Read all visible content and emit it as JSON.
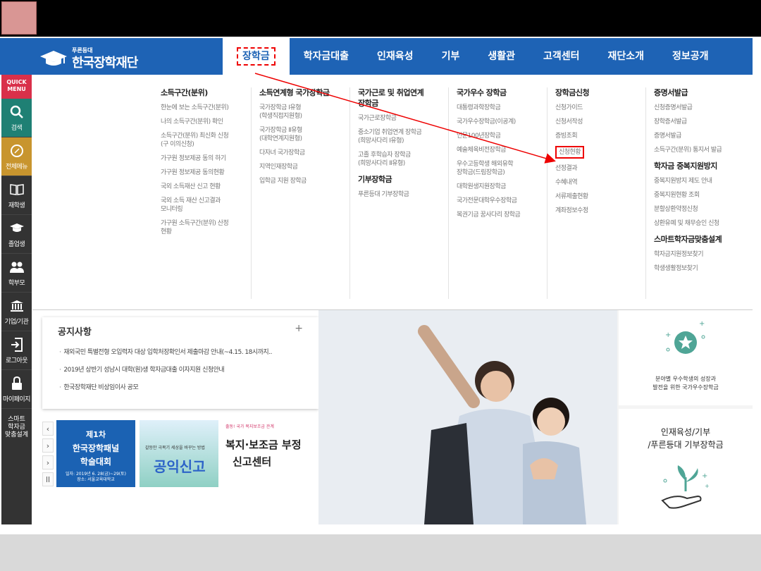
{
  "logo": {
    "small": "푸른등대",
    "name": "한국장학재단"
  },
  "nav": {
    "items": [
      "장학금",
      "학자금대출",
      "인재육성",
      "기부",
      "생활관",
      "고객센터",
      "재단소개",
      "정보공개"
    ]
  },
  "quick_menu": {
    "title_line1": "QUICK",
    "title_line2": "MENU",
    "items": [
      "검색",
      "전체메뉴",
      "재학생",
      "졸업생",
      "학부모",
      "기업/기관",
      "로그아웃",
      "마이페이지"
    ],
    "smart_line1": "스마트",
    "smart_line2": "학자금",
    "smart_line3": "맞춤설계"
  },
  "mega": {
    "col1": {
      "head": "소득구간(분위)",
      "items": [
        "한눈에 보는 소득구간(분위)",
        "나의 소득구간(분위) 확인",
        "소득구간(분위) 최신화 신청",
        "(구 이의신청)",
        "가구원 정보제공 동의 하기",
        "가구원 정보제공 동의현황",
        "국외 소득재산 신고 현황",
        "국외 소득 재산 신고결과",
        "모니터링",
        "가구원 소득구간(분위) 산정",
        "현황"
      ]
    },
    "col2": {
      "head": "소득연계형 국가장학금",
      "items": [
        "국가장학금 Ⅰ유형",
        "(학생직접지원형)",
        "국가장학금 Ⅱ유형",
        "(대학연계지원형)",
        "다자녀 국가장학금",
        "지역인재장학금",
        "입학금 지원 장학금"
      ]
    },
    "col3": {
      "head_line1": "국가근로 및 취업연계",
      "head_line2": "장학금",
      "items": [
        "국가근로장학금",
        "중소기업 취업연계 장학금",
        "(희망사다리 Ⅰ유형)",
        "고졸 후학습자 장학금",
        "(희망사다리 Ⅱ유형)"
      ],
      "head2": "기부장학금",
      "items2": [
        "푸른등대 기부장학금"
      ]
    },
    "col4": {
      "head": "국가우수 장학금",
      "items": [
        "대통령과학장학금",
        "국가우수장학금(이공계)",
        "인문100년장학금",
        "예술체육비전장학금",
        "우수고등학생 해외유학",
        "장학금(드림장학금)",
        "대학원생지원장학금",
        "국가전문대학우수장학금",
        "복권기금 꿈사다리 장학금"
      ]
    },
    "col5": {
      "head": "장학금신청",
      "items": [
        "신청가이드",
        "신청서작성",
        "증빙조회",
        "신청현황",
        "선정결과",
        "수혜내역",
        "서류제출현황",
        "계좌정보수정"
      ]
    },
    "col6": {
      "head": "증명서발급",
      "items": [
        "신청증명서발급",
        "장학증서발급",
        "증명서발급",
        "소득구간(분위) 통지서 발급"
      ],
      "head2": "학자금 중복지원방지",
      "items2": [
        "중복지원방지 제도 안내",
        "중복지원현황 조회",
        "분할상환약정신청",
        "상환유예 및 채무승인 신청"
      ],
      "head3": "스마트학자금맞춤설계",
      "items3": [
        "학자금지원정보찾기",
        "학생생활정보찾기"
      ]
    }
  },
  "notice": {
    "title": "공지사항",
    "plus": "+",
    "items": [
      "재외국민 특별전형 오입력자 대상 입학처장확인서 제출마감 안내(~4.15. 18시까지..",
      "2019년 상반기 성남시 대학(원)생 학자금대출 이자지원 신청안내",
      "한국장학재단 비상임이사 공모"
    ]
  },
  "banners": {
    "controls": [
      "‹",
      "›",
      "›",
      "ll"
    ],
    "b1": {
      "line1": "제1차",
      "line2": "한국장학패널",
      "line3": "학술대회",
      "line4": "일자: 2019년 6. 28(금)~29(토)",
      "line5": "장소: 서울교육대학교"
    },
    "b2": {
      "small": "갈등만 극복기 세상을 바꾸는 방법",
      "big": "공익신고"
    },
    "b3": {
      "small": "출동! 국가 복지보조금 관계",
      "line1": "복지·보조금 부정",
      "line2": "신고센터"
    }
  },
  "right": {
    "card1_line1": "분야별 우수학생의 성장과",
    "card1_line2": "발전을 위한 국가우수장학금",
    "card2_line1": "인재육성/기부",
    "card2_line2": "/푸른등대 기부장학금"
  },
  "colors": {
    "nav_blue": "#1e63b5",
    "highlight_red": "#e00000",
    "quick_pink": "#d9304a",
    "quick_orange": "#c8952e",
    "quick_teal": "#1f8074"
  }
}
